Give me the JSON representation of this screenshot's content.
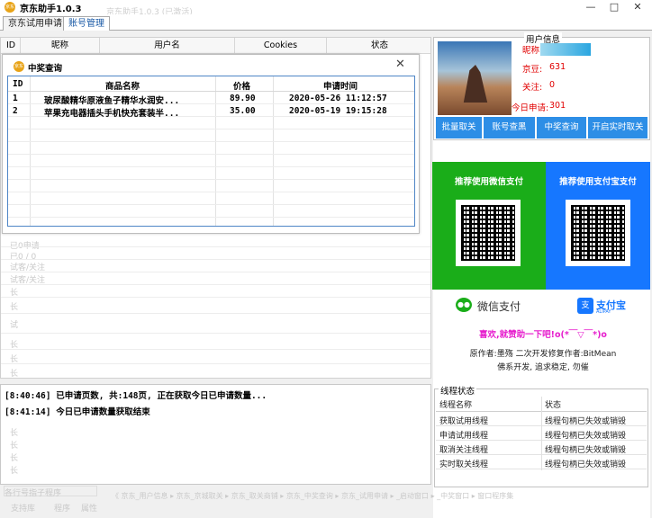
{
  "window": {
    "title": "京东助手1.0.3",
    "app_icon": "app-logo-icon",
    "ghost_title": "京东助手1.0.3 (已激活)",
    "controls": {
      "minimize": "—",
      "maximize": "□",
      "close": "✕"
    }
  },
  "tabs": [
    {
      "label": "京东试用申请"
    },
    {
      "label": "账号管理",
      "active": true
    }
  ],
  "grid": {
    "columns": [
      "ID",
      "昵称",
      "用户名",
      "Cookies",
      "状态"
    ],
    "ghost_rows": [
      "已0申请",
      "已0 / 0",
      "试客/关注",
      "试客/关注",
      "长",
      "长",
      "试",
      "长",
      "长",
      "长",
      "长",
      "长",
      "长",
      "长"
    ]
  },
  "popup": {
    "title": "中奖查询",
    "icon": "app-logo-icon",
    "close": "✕",
    "columns": [
      "ID",
      "商品名称",
      "价格",
      "申请时间"
    ],
    "rows": [
      {
        "id": "1",
        "name": "玻尿酸精华原液鱼子精华水润安...",
        "price": "89.90",
        "time": "2020-05-26 11:12:57"
      },
      {
        "id": "2",
        "name": "苹果充电器插头手机快充套装半...",
        "price": "35.00",
        "time": "2020-05-19 19:15:28"
      }
    ]
  },
  "user": {
    "legend": "用户信息",
    "nickname_label": "昵称:",
    "beans_label": "京豆:",
    "beans": "631",
    "follow_label": "关注:",
    "follow": "0",
    "today_label": "今日申请:",
    "today": "301",
    "buttons": [
      "批量取关",
      "账号查黑",
      "中奖查询",
      "开启实时取关"
    ]
  },
  "pay": {
    "wechat_title": "推荐使用微信支付",
    "alipay_title": "推荐使用支付宝支付",
    "wechat_label": "微信支付",
    "alipay_label": "支付宝",
    "alipay_sub": "ALIPAY",
    "thanks": "喜欢,就赞助一下吧!o(*￣▽￣*)o",
    "credit_line": "原作者:墨殇   二次开发修复作者:BitMean",
    "motto": "佛系开发, 追求稳定, 勿催"
  },
  "log": {
    "lines": [
      "[8:40:46] 已申请页数, 共:148页, 正在获取今日已申请数量...",
      "[8:41:14] 今日已申请数量获取结束"
    ]
  },
  "threads": {
    "legend": "线程状态",
    "columns": [
      "线程名称",
      "状态"
    ],
    "rows": [
      {
        "name": "获取试用线程",
        "status": "线程句柄已失效或销毁"
      },
      {
        "name": "申请试用线程",
        "status": "线程句柄已失效或销毁"
      },
      {
        "name": "取消关注线程",
        "status": "线程句柄已失效或销毁"
      },
      {
        "name": "实时取关线程",
        "status": "线程句柄已失效或销毁"
      }
    ]
  },
  "ghost_bottom": {
    "select": "各行号指子程序",
    "tabs": [
      "支持库",
      "程序",
      "属性"
    ],
    "strip": "《  京东_用户信息 ▸ 京东_京城取关 ▸ 京东_取关商铺 ▸ 京东_中奖查询 ▸ 京东_试用申请 ▸ _启动窗口 ▸ _中奖窗口 ▸ 窗口程序集"
  },
  "colors": {
    "accent": "#2d8ee6",
    "wechat": "#1aad19",
    "alipay": "#1677ff",
    "highlight": "#e10000",
    "thanks": "#e61ecd"
  }
}
